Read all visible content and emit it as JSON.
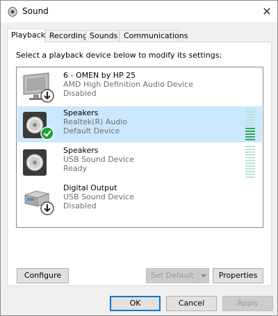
{
  "window": {
    "title": "Sound",
    "close_glyph": "✕"
  },
  "tabs": [
    {
      "label": "Playback",
      "active": true
    },
    {
      "label": "Recording"
    },
    {
      "label": "Sounds"
    },
    {
      "label": "Communications"
    }
  ],
  "playback": {
    "instruction": "Select a playback device below to modify its settings:",
    "devices": [
      {
        "name": "6 - OMEN by HP 25",
        "driver": "AMD High Definition Audio Device",
        "status": "Disabled",
        "icon": "monitor-icon",
        "badge": "disabled-down-arrow-icon",
        "selected": false
      },
      {
        "name": "Speakers",
        "driver": "Realtek(R) Audio",
        "status": "Default Device",
        "icon": "speaker-icon",
        "badge": "default-check-icon",
        "selected": true,
        "level": 0.4
      },
      {
        "name": "Speakers",
        "driver": "USB Sound Device",
        "status": "Ready",
        "icon": "speaker-icon",
        "badge": null,
        "selected": false,
        "level": 0
      },
      {
        "name": "Digital Output",
        "driver": "USB Sound Device",
        "status": "Disabled",
        "icon": "digital-output-icon",
        "badge": "disabled-down-arrow-icon",
        "selected": false
      }
    ],
    "configure_label": "Configure",
    "set_default_label": "Set Default",
    "properties_label": "Properties"
  },
  "footer": {
    "ok_label": "OK",
    "cancel_label": "Cancel",
    "apply_label": "Apply"
  },
  "colors": {
    "selection": "#cce8ff",
    "meter_active": "#2fa84f",
    "meter_idle": "#b9e3dc",
    "accent": "#0078d7"
  }
}
